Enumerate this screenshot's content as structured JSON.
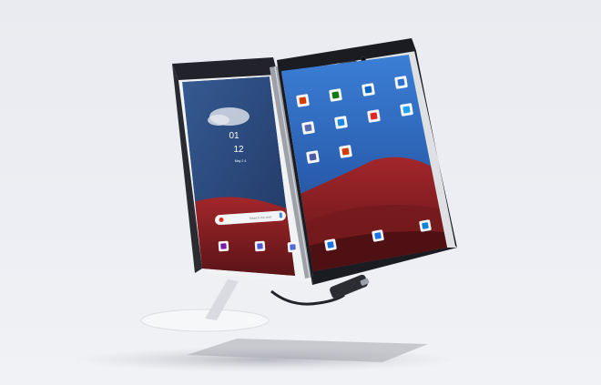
{
  "left_screen": {
    "clock_hour": "01",
    "clock_minute": "12",
    "clock_date": "May 2 4",
    "search_placeholder": "Search the web"
  },
  "colors": {
    "background": "#eceef3",
    "bezel": "#1b1c22",
    "sky_left": "#2f4f86",
    "sky_right": "#2b63b8",
    "dune_red": "#8b1d1d",
    "dune_dark": "#4d1216"
  },
  "right_screen": {
    "apps": [
      {
        "icon": "office-icon",
        "color": "#d83b01"
      },
      {
        "icon": "xbox-icon",
        "color": "#107c10"
      },
      {
        "icon": "outlook-icon",
        "color": "#0a64c2"
      },
      {
        "icon": "photos-icon",
        "color": "#2b6fd1"
      },
      {
        "icon": "tiles-folder-icon",
        "color": "#5a6ab0"
      },
      {
        "icon": "play-store-icon",
        "color": "#1e88e5"
      },
      {
        "icon": "flipboard-icon",
        "color": "#e12828"
      },
      {
        "icon": "twitter-icon",
        "color": "#1da1f2"
      },
      {
        "icon": "apps-folder-icon",
        "color": "#4a5aa8"
      },
      {
        "icon": "office-docs-icon",
        "color": "#d83b01"
      }
    ],
    "dock": [
      {
        "icon": "phone-icon",
        "color": "#1a73e8"
      },
      {
        "icon": "messages-icon",
        "color": "#1a73e8"
      },
      {
        "icon": "edge-icon",
        "color": "#0a84d8"
      }
    ]
  },
  "left_dock": [
    {
      "icon": "onenote-icon",
      "color": "#7719aa"
    },
    {
      "icon": "teams-icon",
      "color": "#5059c9"
    },
    {
      "icon": "store-icon",
      "color": "#4f6bd8"
    }
  ]
}
